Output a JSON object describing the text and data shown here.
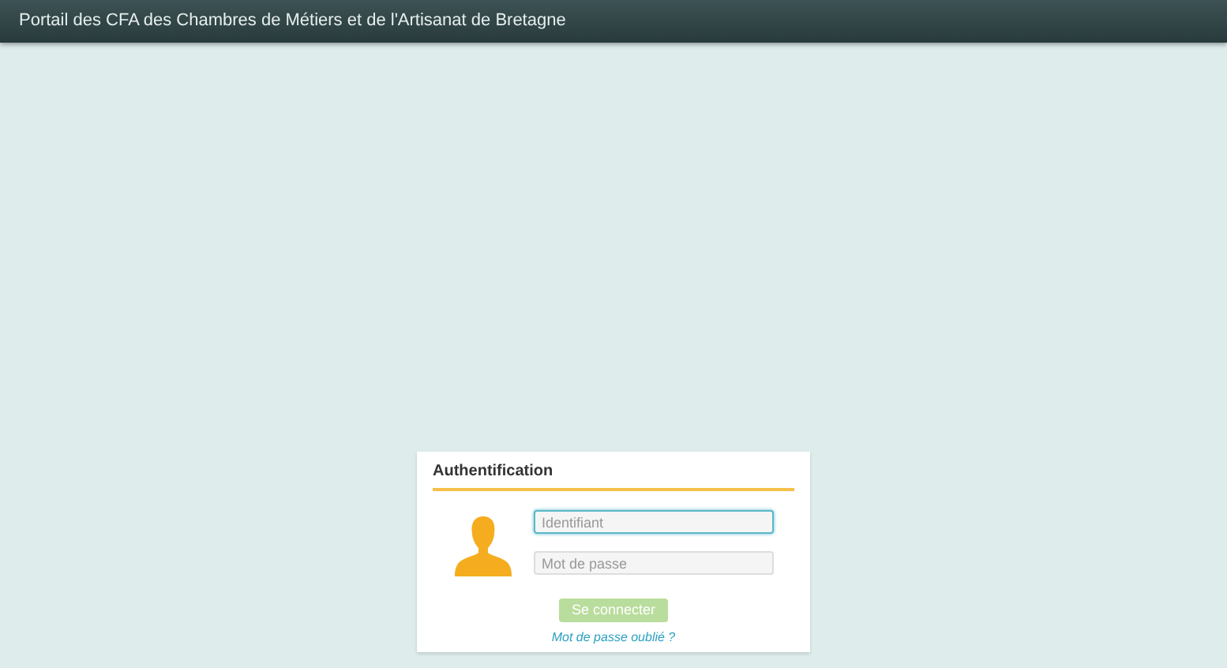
{
  "header": {
    "title": "Portail des CFA des Chambres de Métiers et de l'Artisanat de Bretagne"
  },
  "login": {
    "title": "Authentification",
    "fields": [
      {
        "placeholder": "Identifiant",
        "focused": true
      },
      {
        "placeholder": "Mot de passe",
        "focused": false
      }
    ],
    "submit": {
      "label": "Se connecter",
      "disabled": true
    },
    "forgot_link": "Mot de passe oublié ?"
  }
}
